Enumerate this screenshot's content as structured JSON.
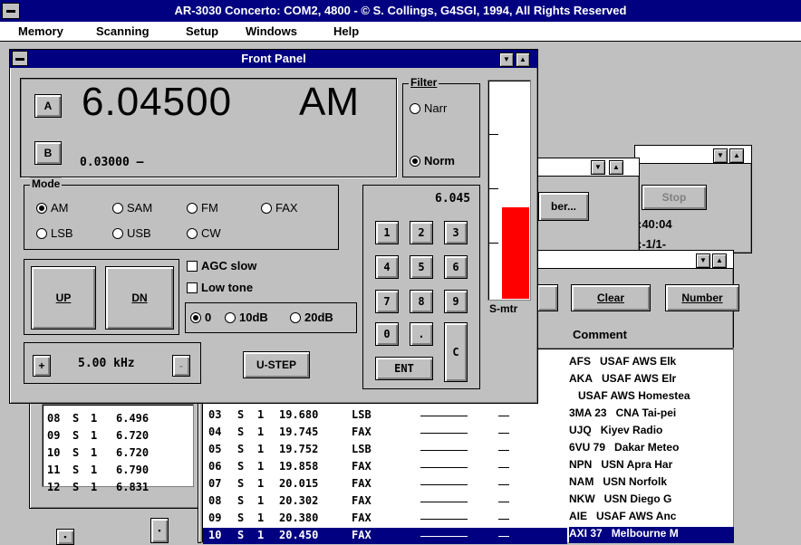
{
  "app": {
    "title": "AR-3030 Concerto: COM2, 4800 - © S. Collings, G4SGI, 1994, All Rights Reserved"
  },
  "menu": [
    "Memory",
    "Scanning",
    "Setup",
    "Windows",
    "Help"
  ],
  "front_panel": {
    "title": "Front Panel",
    "vfo_a_label": "A",
    "vfo_a_freq": "6.04500",
    "vfo_a_mode": "AM",
    "vfo_b_label": "B",
    "vfo_b_freq": "0.03000 —",
    "filter_label": "Filter",
    "filter_options": [
      "Narr",
      "Norm"
    ],
    "filter_selected": "Norm",
    "mode_label": "Mode",
    "modes": [
      "AM",
      "SAM",
      "FM",
      "FAX",
      "LSB",
      "USB",
      "CW"
    ],
    "mode_selected": "AM",
    "up_label": "UP",
    "dn_label": "DN",
    "agc_label": "AGC slow",
    "low_tone_label": "Low tone",
    "atten_options": [
      "0",
      "10dB",
      "20dB"
    ],
    "atten_selected": "0",
    "step_plus": "+",
    "step_minus": "-",
    "step_value": "5.00 kHz",
    "ustep_label": "U-STEP",
    "keypad_display": "6.045",
    "keys": [
      "1",
      "2",
      "3",
      "4",
      "5",
      "6",
      "7",
      "8",
      "9",
      "0",
      "."
    ],
    "key_c": "C",
    "key_ent": "ENT",
    "smeter_label": "S-mtr",
    "smeter_level": 0.42
  },
  "scan_window": {
    "stop_label": "Stop",
    "number_btn_partial": "ber...",
    "time_text": ":40:04",
    "partial_text": ":-1/1-"
  },
  "list_window": {
    "clear_label": "Clear",
    "number_label": "Number",
    "comment_header": "Comment",
    "comments": [
      {
        "code": "AFS",
        "text": "USAF AWS Elk"
      },
      {
        "code": "AKA",
        "text": "USAF AWS Elr"
      },
      {
        "code": "",
        "text": "USAF AWS Homestea"
      },
      {
        "code": "3MA 23",
        "text": "CNA Tai-pei"
      },
      {
        "code": "UJQ",
        "text": "Kiyev Radio"
      },
      {
        "code": "6VU 79",
        "text": "Dakar Meteo"
      },
      {
        "code": "NPN",
        "text": "USN Apra Har"
      },
      {
        "code": "NAM",
        "text": "USN Norfolk"
      },
      {
        "code": "NKW",
        "text": "USN Diego G"
      },
      {
        "code": "AIE",
        "text": "USAF AWS Anc"
      },
      {
        "code": "AXI 37",
        "text": "Melbourne M"
      }
    ],
    "rows": [
      {
        "ch": "03",
        "s": "S",
        "n": "1",
        "freq": "19.680",
        "mode": "LSB"
      },
      {
        "ch": "04",
        "s": "S",
        "n": "1",
        "freq": "19.745",
        "mode": "FAX"
      },
      {
        "ch": "05",
        "s": "S",
        "n": "1",
        "freq": "19.752",
        "mode": "LSB"
      },
      {
        "ch": "06",
        "s": "S",
        "n": "1",
        "freq": "19.858",
        "mode": "FAX"
      },
      {
        "ch": "07",
        "s": "S",
        "n": "1",
        "freq": "20.015",
        "mode": "FAX"
      },
      {
        "ch": "08",
        "s": "S",
        "n": "1",
        "freq": "20.302",
        "mode": "FAX"
      },
      {
        "ch": "09",
        "s": "S",
        "n": "1",
        "freq": "20.380",
        "mode": "FAX"
      },
      {
        "ch": "10",
        "s": "S",
        "n": "1",
        "freq": "20.450",
        "mode": "FAX"
      }
    ]
  },
  "left_list": {
    "rows": [
      {
        "ch": "08",
        "s": "S",
        "n": "1",
        "freq": "6.496"
      },
      {
        "ch": "09",
        "s": "S",
        "n": "1",
        "freq": "6.720"
      },
      {
        "ch": "10",
        "s": "S",
        "n": "1",
        "freq": "6.720"
      },
      {
        "ch": "11",
        "s": "S",
        "n": "1",
        "freq": "6.790"
      },
      {
        "ch": "12",
        "s": "S",
        "n": "1",
        "freq": "6.831"
      }
    ]
  },
  "colors": {
    "title_active": "#000080",
    "smeter_bar": "#ff0000",
    "selection": "#000080"
  }
}
